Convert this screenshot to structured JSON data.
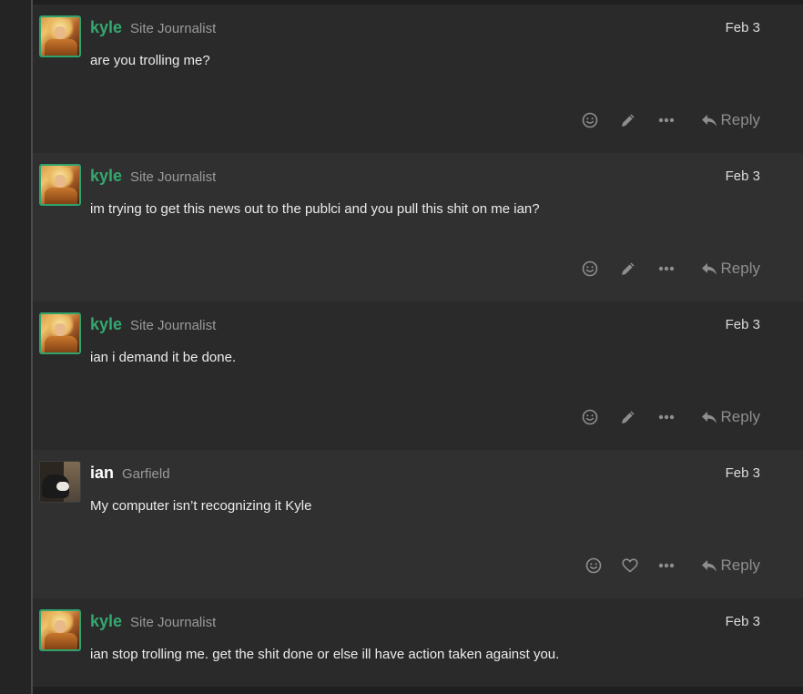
{
  "posts": [
    {
      "username": "kyle",
      "title": "Site Journalist",
      "date": "Feb 3",
      "body": "are you trolling me?",
      "avatar": "kyle-avatar",
      "second_action": "edit"
    },
    {
      "username": "kyle",
      "title": "Site Journalist",
      "date": "Feb 3",
      "body": "im trying to get this news out to the publci and you pull this shit on me ian?",
      "avatar": "kyle-avatar",
      "second_action": "edit"
    },
    {
      "username": "kyle",
      "title": "Site Journalist",
      "date": "Feb 3",
      "body": "ian i demand it be done.",
      "avatar": "kyle-avatar",
      "second_action": "edit"
    },
    {
      "username": "ian",
      "title": "Garfield",
      "date": "Feb 3",
      "body": "My computer isn’t recognizing it Kyle",
      "avatar": "ian-avatar",
      "second_action": "like"
    },
    {
      "username": "kyle",
      "title": "Site Journalist",
      "date": "Feb 3",
      "body": "ian stop trolling me. get the shit done or else ill have action taken against you.",
      "avatar": "kyle-avatar",
      "second_action": "none"
    }
  ],
  "actions": {
    "reply_label": "Reply"
  },
  "colors": {
    "username_green": "#34a86f",
    "username_white": "#ffffff",
    "post_bg_a": "#2a2a2a",
    "post_bg_b": "#303030"
  }
}
